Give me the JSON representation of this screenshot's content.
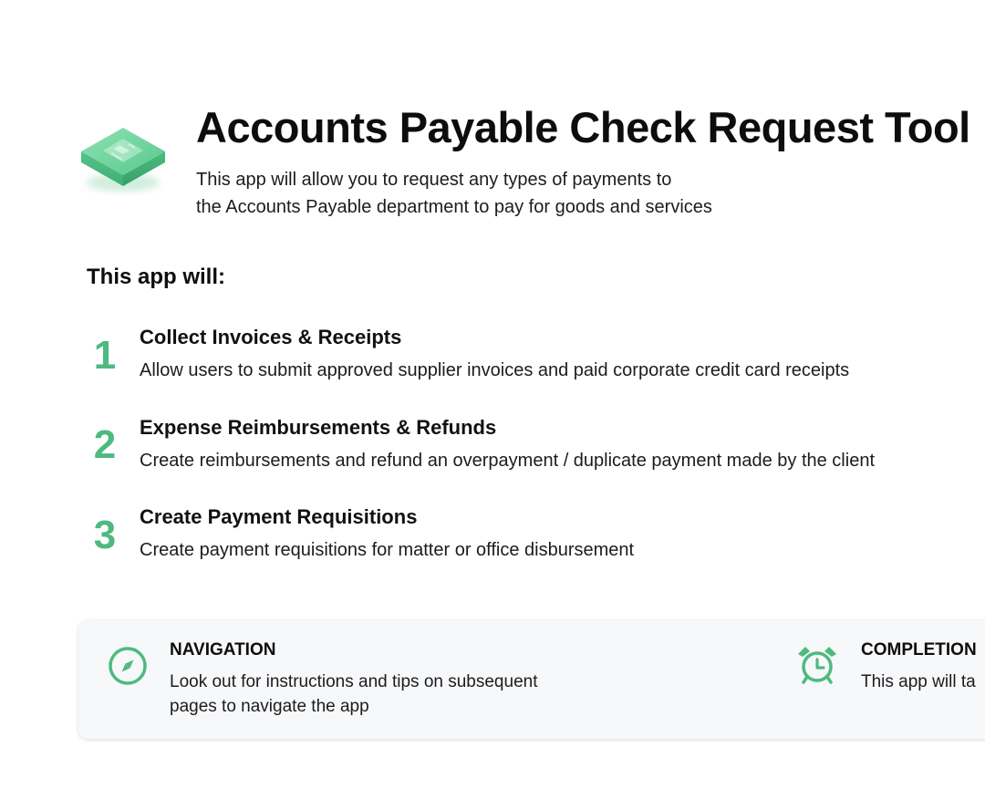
{
  "header": {
    "title": "Accounts Payable Check Request Tool",
    "subtitle_lines": [
      "This app will allow you to request any types of payments to",
      "the Accounts Payable department to pay for goods and services"
    ]
  },
  "features": {
    "heading": "This app will:",
    "items": [
      {
        "number": "1",
        "title": "Collect Invoices & Receipts",
        "description": "Allow users to submit approved supplier invoices and paid corporate credit card receipts"
      },
      {
        "number": "2",
        "title": "Expense Reimbursements & Refunds",
        "description": "Create reimbursements and refund an overpayment / duplicate payment made by the client"
      },
      {
        "number": "3",
        "title": "Create Payment Requisitions",
        "description": "Create payment requisitions for matter or office disbursement"
      }
    ]
  },
  "info_card": {
    "navigation": {
      "icon": "compass-icon",
      "title": "NAVIGATION",
      "lines": [
        "Look out for instructions and tips on subsequent",
        "pages to navigate the app"
      ]
    },
    "completion": {
      "icon": "alarm-clock-icon",
      "title": "COMPLETION",
      "lines": [
        "This app will ta"
      ]
    }
  },
  "colors": {
    "accent": "#4dba7f",
    "card_background": "#f7f8fa",
    "text": "#111111"
  }
}
